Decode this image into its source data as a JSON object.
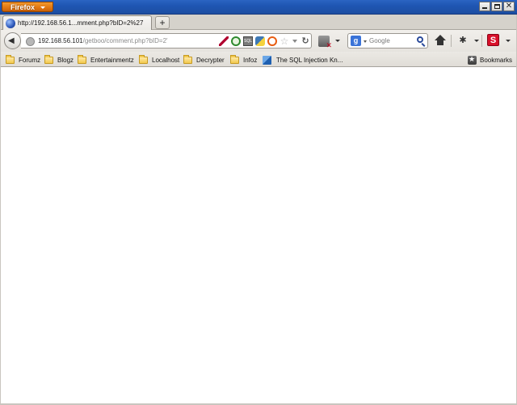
{
  "window": {
    "menu_label": "Firefox",
    "controls": [
      "minimize",
      "maximize",
      "close"
    ]
  },
  "tabs": [
    {
      "label": "http://192.168.56.1...mment.php?bID=2%27",
      "icon": "globe-favicon-icon",
      "active": true
    }
  ],
  "navbar": {
    "url_host": "192.168.56.101",
    "url_path": "/getboo/comment.php?bID=2'",
    "search_placeholder": "Google",
    "search_engine_icon": "google-icon"
  },
  "bookmarks": {
    "items": [
      {
        "label": "Forumz",
        "icon": "folder-icon"
      },
      {
        "label": "Blogz",
        "icon": "folder-icon"
      },
      {
        "label": "Entertainmentz",
        "icon": "folder-icon"
      },
      {
        "label": "Localhost",
        "icon": "folder-icon"
      },
      {
        "label": "Decrypter",
        "icon": "folder-icon"
      },
      {
        "label": "Infoz",
        "icon": "folder-icon"
      },
      {
        "label": "The SQL Injection Kn...",
        "icon": "page-icon"
      }
    ],
    "menu_label": "Bookmarks"
  },
  "colors": {
    "titlebar": "#1f56b3",
    "firefox_button": "#e07611",
    "content_background": "#ffffff"
  }
}
